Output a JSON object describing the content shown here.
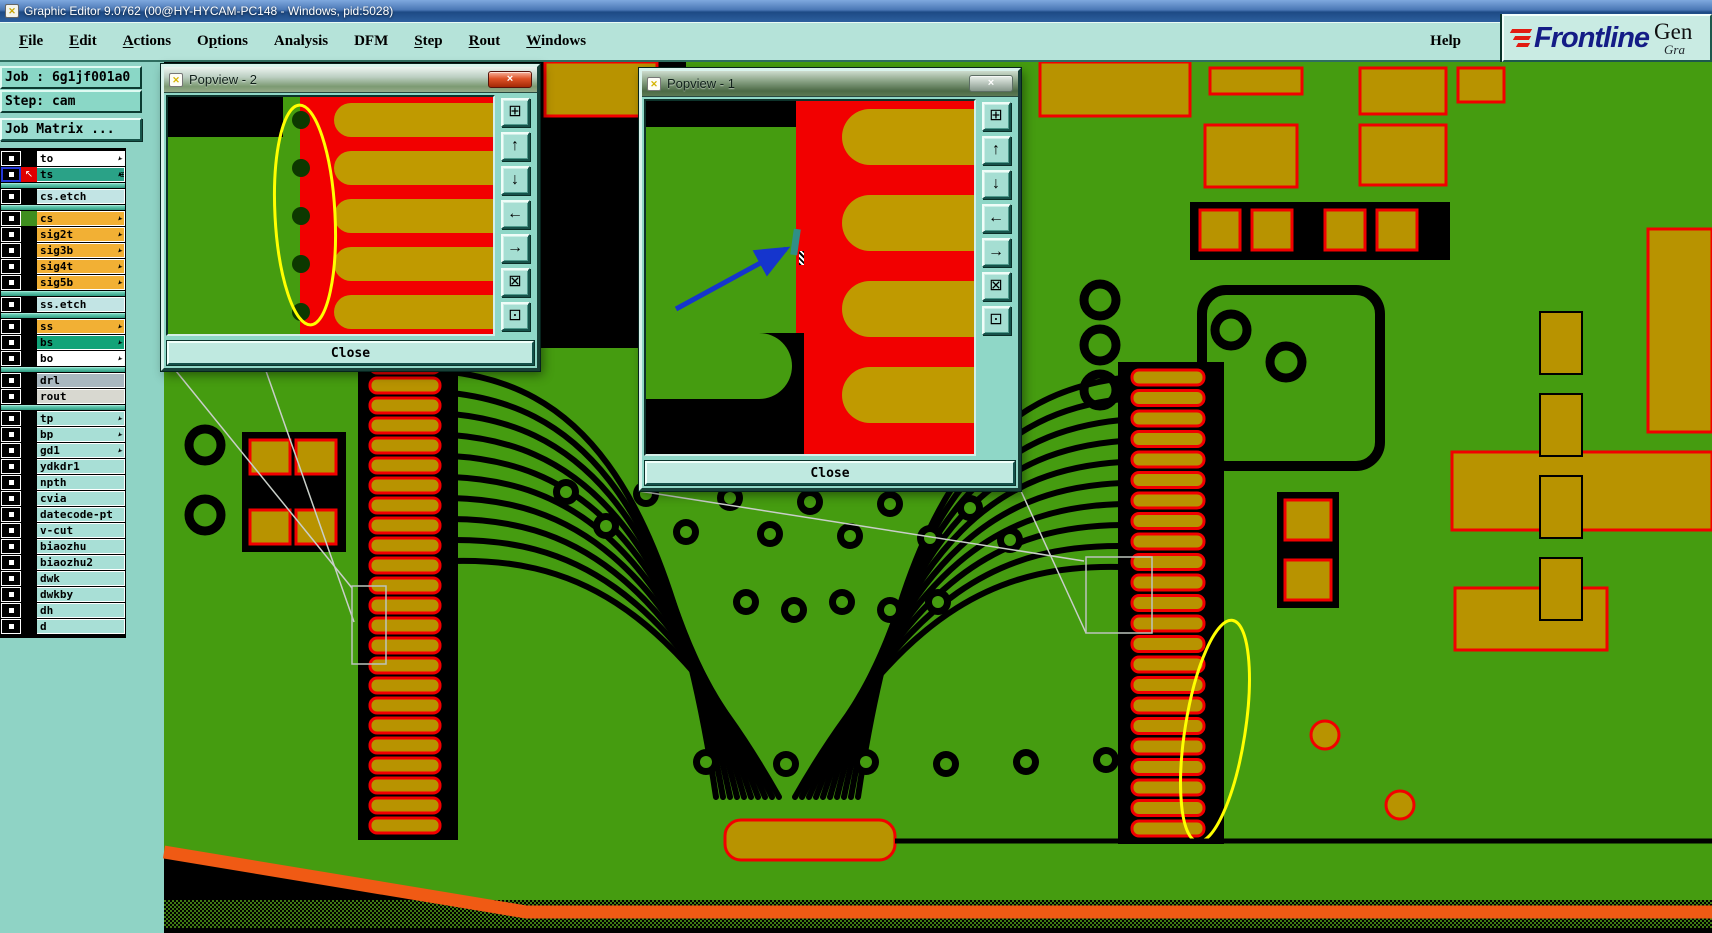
{
  "window": {
    "title": "Graphic Editor 9.0762 (00@HY-HYCAM-PC148 - Windows, pid:5028)"
  },
  "menu": {
    "items": [
      {
        "label": "File",
        "underline": 0
      },
      {
        "label": "Edit",
        "underline": 0
      },
      {
        "label": "Actions",
        "underline": 0
      },
      {
        "label": "Options",
        "underline": 1
      },
      {
        "label": "Analysis",
        "underline": -1
      },
      {
        "label": "DFM",
        "underline": -1
      },
      {
        "label": "Step",
        "underline": 0
      },
      {
        "label": "Rout",
        "underline": 0
      },
      {
        "label": "Windows",
        "underline": 0
      }
    ],
    "help": {
      "label": "Help",
      "underline": -1
    }
  },
  "brand": {
    "name": "Frontline",
    "product": "Gen",
    "product_sub": "Gra"
  },
  "job_panel": {
    "job": "Job : 6g1jf001a0",
    "step": "Step: cam",
    "matrix_button": "Job Matrix ..."
  },
  "layers": {
    "rows": [
      {
        "name": "to",
        "bg": "#ffffff",
        "arrow": true
      },
      {
        "name": "ts",
        "bg": "#2aa287",
        "arrow": true,
        "selected": true,
        "work": true,
        "grid": true
      },
      {
        "sep": true
      },
      {
        "name": "cs.etch",
        "bg": "#c2e4e4",
        "arrow": false
      },
      {
        "sep": true
      },
      {
        "name": "cs",
        "bg": "#f2b034",
        "arrow": true,
        "swatch": "#3f8f1f"
      },
      {
        "name": "sig2t",
        "bg": "#f2b034",
        "arrow": true
      },
      {
        "name": "sig3b",
        "bg": "#f2b034",
        "arrow": true
      },
      {
        "name": "sig4t",
        "bg": "#f2b034",
        "arrow": true
      },
      {
        "name": "sig5b",
        "bg": "#f2b034",
        "arrow": true
      },
      {
        "sep": true
      },
      {
        "name": "ss.etch",
        "bg": "#c2e4e4",
        "arrow": false
      },
      {
        "sep": true
      },
      {
        "name": "ss",
        "bg": "#f2b034",
        "arrow": true
      },
      {
        "name": "bs",
        "bg": "#12a378",
        "arrow": true
      },
      {
        "name": "bo",
        "bg": "#ffffff",
        "arrow": true
      },
      {
        "sep": true
      },
      {
        "name": "drl",
        "bg": "#a9b8c0",
        "arrow": false
      },
      {
        "name": "rout",
        "bg": "#d8d8d0",
        "arrow": false
      },
      {
        "sep": true
      },
      {
        "name": "tp",
        "bg": "#a8dfd6",
        "arrow": true
      },
      {
        "name": "bp",
        "bg": "#a8dfd6",
        "arrow": true
      },
      {
        "name": "gd1",
        "bg": "#a8dfd6",
        "arrow": true
      },
      {
        "name": "ydkdr1",
        "bg": "#a8dfd6",
        "arrow": false
      },
      {
        "name": "npth",
        "bg": "#a8dfd6",
        "arrow": false
      },
      {
        "name": "cvia",
        "bg": "#a8dfd6",
        "arrow": false
      },
      {
        "name": "datecode-pt",
        "bg": "#a8dfd6",
        "arrow": false
      },
      {
        "name": "v-cut",
        "bg": "#a8dfd6",
        "arrow": false
      },
      {
        "name": "biaozhu",
        "bg": "#a8dfd6",
        "arrow": false
      },
      {
        "name": "biaozhu2",
        "bg": "#a8dfd6",
        "arrow": false
      },
      {
        "name": "dwk",
        "bg": "#a8dfd6",
        "arrow": false
      },
      {
        "name": "dwkby",
        "bg": "#a8dfd6",
        "arrow": false
      },
      {
        "name": "dh",
        "bg": "#a8dfd6",
        "arrow": false
      },
      {
        "name": "d",
        "bg": "#a8dfd6",
        "arrow": false
      }
    ]
  },
  "popups": [
    {
      "title": "Popview - 2",
      "close_label": "Close",
      "close_glyph": "×"
    },
    {
      "title": "Popview - 1",
      "close_label": "Close",
      "close_glyph": "×"
    }
  ],
  "popup_toolbar": {
    "icons": [
      {
        "name": "duplicate-view-icon",
        "glyph": "⊞"
      },
      {
        "name": "pan-up-icon",
        "glyph": "↑"
      },
      {
        "name": "pan-down-icon",
        "glyph": "↓"
      },
      {
        "name": "pan-left-icon",
        "glyph": "←"
      },
      {
        "name": "pan-right-icon",
        "glyph": "→"
      },
      {
        "name": "zoom-fit-icon",
        "glyph": "⊠"
      },
      {
        "name": "center-view-icon",
        "glyph": "⊡"
      }
    ]
  },
  "canvas": {
    "bg": "#459c10",
    "copper_gold": "#b89300",
    "pad_red": "#f20000",
    "outline_orange": "#f05a14",
    "annotation_yellow": "#ffff00",
    "arrow_blue": "#1535cd",
    "left_connector_pads": 24,
    "right_connector_pads": 23,
    "popview2_pads": 5,
    "popview1_pads": 4
  }
}
